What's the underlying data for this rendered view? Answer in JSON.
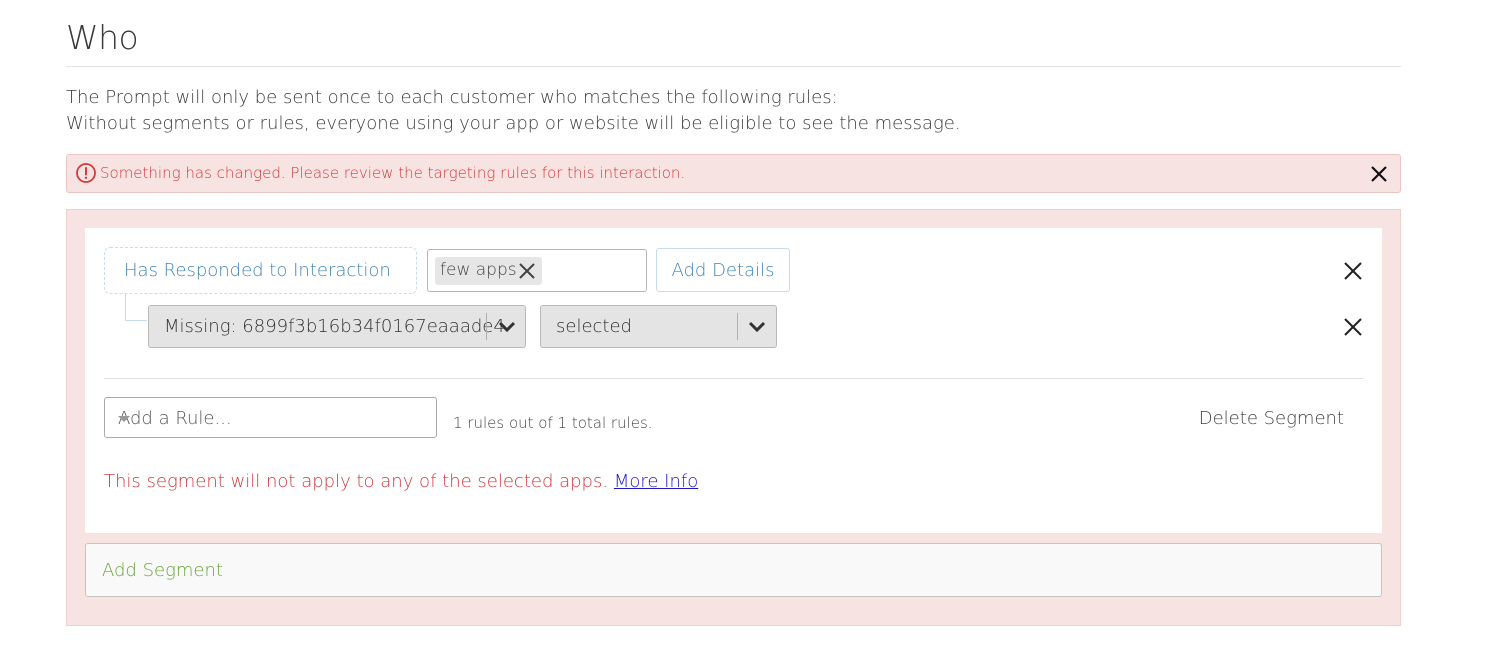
{
  "section": {
    "title": "Who",
    "description_line1": "The Prompt will only be sent once to each customer who matches the following rules:",
    "description_line2": "Without segments or rules, everyone using your app or website will be eligible to see the message."
  },
  "alert": {
    "icon": "alert-circle-icon",
    "text": "Something has changed. Please review the targeting rules for this interaction.",
    "close_icon": "close-icon",
    "color": "#d23c3c"
  },
  "segment": {
    "criterion_label": "Has Responded to Interaction",
    "tag": {
      "label": "few apps",
      "remove_icon": "close-icon"
    },
    "add_details_label": "Add Details",
    "condition": {
      "field_value": "Missing: 6899f3b16b34f0167eaaade4",
      "operator_value": "selected"
    },
    "add_rule_placeholder": "Add a Rule...",
    "rules_count_text": "1 rules out of 1 total rules.",
    "delete_label": "Delete Segment",
    "warning_text": "This segment will not apply to any of the selected apps.",
    "more_info_label": "More Info"
  },
  "add_segment_label": "Add Segment",
  "colors": {
    "accent_blue": "#3f87b6",
    "error_red": "#d0393c",
    "success_green": "#6aa43c",
    "alert_bg": "#f7e3e1"
  }
}
